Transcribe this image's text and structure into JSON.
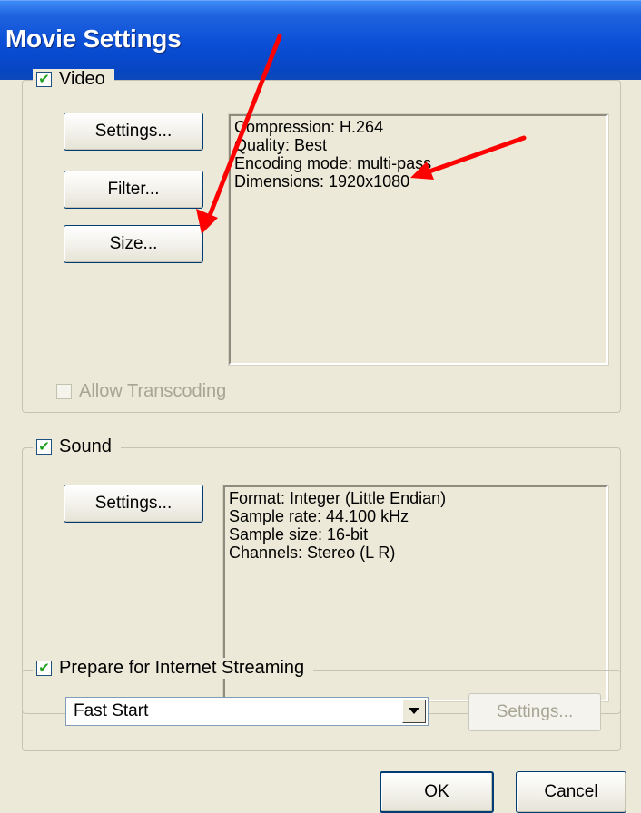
{
  "window": {
    "title": "Movie Settings"
  },
  "video": {
    "label": "Video",
    "checked": true,
    "buttons": {
      "settings": "Settings...",
      "filter": "Filter...",
      "size": "Size..."
    },
    "info": [
      "Compression: H.264",
      "Quality: Best",
      "Encoding mode: multi-pass",
      "Dimensions: 1920x1080"
    ],
    "allow_transcoding": {
      "label": "Allow Transcoding",
      "checked": false,
      "enabled": false
    }
  },
  "sound": {
    "label": "Sound",
    "checked": true,
    "buttons": {
      "settings": "Settings..."
    },
    "info": [
      "Format: Integer (Little Endian)",
      "Sample rate: 44.100 kHz",
      "Sample size: 16-bit",
      "Channels: Stereo (L R)"
    ]
  },
  "streaming": {
    "label": "Prepare for Internet Streaming",
    "checked": true,
    "selected": "Fast Start",
    "settings_button": "Settings..."
  },
  "footer": {
    "ok": "OK",
    "cancel": "Cancel"
  },
  "colors": {
    "annotation_arrow": "#ff0000",
    "titlebar": "#0a4ed6",
    "check": "#21a121"
  }
}
